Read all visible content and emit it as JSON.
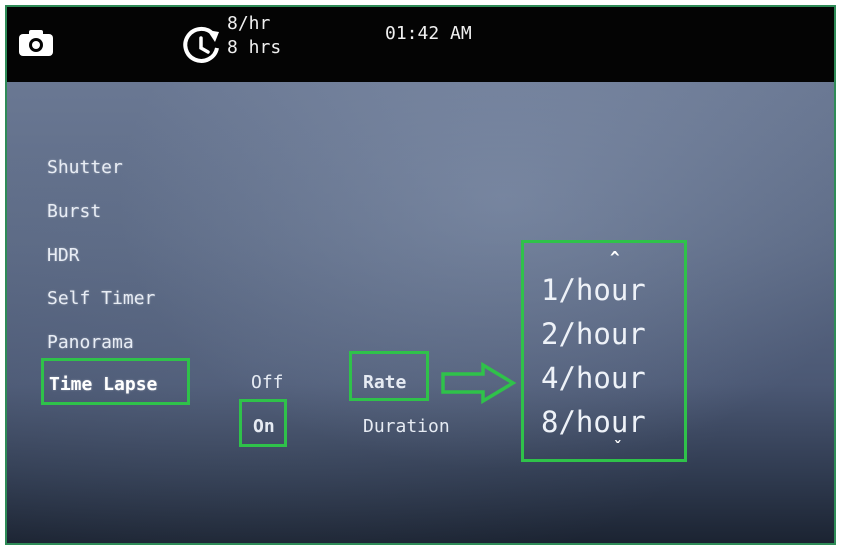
{
  "status_bar": {
    "rate": "8/hr",
    "duration": "8 hrs",
    "time": "01:42 AM"
  },
  "menu": {
    "items": [
      {
        "label": "Shutter"
      },
      {
        "label": "Burst"
      },
      {
        "label": "HDR"
      },
      {
        "label": "Self Timer"
      },
      {
        "label": "Panorama"
      },
      {
        "label": "Time Lapse"
      }
    ]
  },
  "time_lapse": {
    "off_label": "Off",
    "on_label": "On"
  },
  "submenu": {
    "rate_label": "Rate",
    "duration_label": "Duration"
  },
  "rate_list": {
    "up": "^",
    "down": "ˇ",
    "options": [
      "1/hour",
      "2/hour",
      "4/hour",
      "8/hour"
    ]
  },
  "colors": {
    "highlight": "#2fc24a",
    "frame_border": "#2e8b57"
  },
  "icons": [
    "camera-icon",
    "timer-icon",
    "arrow-right-icon",
    "chevron-up-icon",
    "chevron-down-icon"
  ]
}
